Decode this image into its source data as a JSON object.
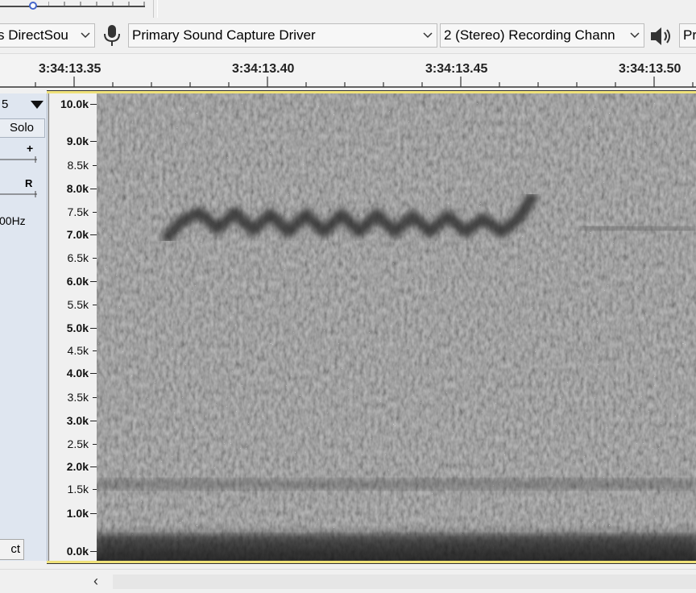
{
  "device_toolbar": {
    "audio_host": "s DirectSou",
    "recording_device": "Primary Sound Capture Driver",
    "recording_channels": "2 (Stereo) Recording Chann",
    "playback_device": "Pr"
  },
  "timeline": {
    "labels": [
      "3:34:13.35",
      "3:34:13.40",
      "3:34:13.45",
      "3:34:13.50"
    ]
  },
  "track": {
    "menu_value": "5",
    "solo_label": "Solo",
    "gain_plus": "+",
    "pan_right": "R",
    "rate_text": "00Hz",
    "select_label": "ct"
  },
  "freq_axis": {
    "labels": [
      "10.0k",
      "9.0k",
      "8.5k",
      "8.0k",
      "7.5k",
      "7.0k",
      "6.5k",
      "6.0k",
      "5.5k",
      "5.0k",
      "4.5k",
      "4.0k",
      "3.5k",
      "3.0k",
      "2.5k",
      "2.0k",
      "1.5k",
      "1.0k",
      "0.0k"
    ]
  },
  "scrollbar": {
    "left_arrow": "‹"
  },
  "colors": {
    "accent": "#4466cc",
    "selection_border": "#f0e27a"
  }
}
